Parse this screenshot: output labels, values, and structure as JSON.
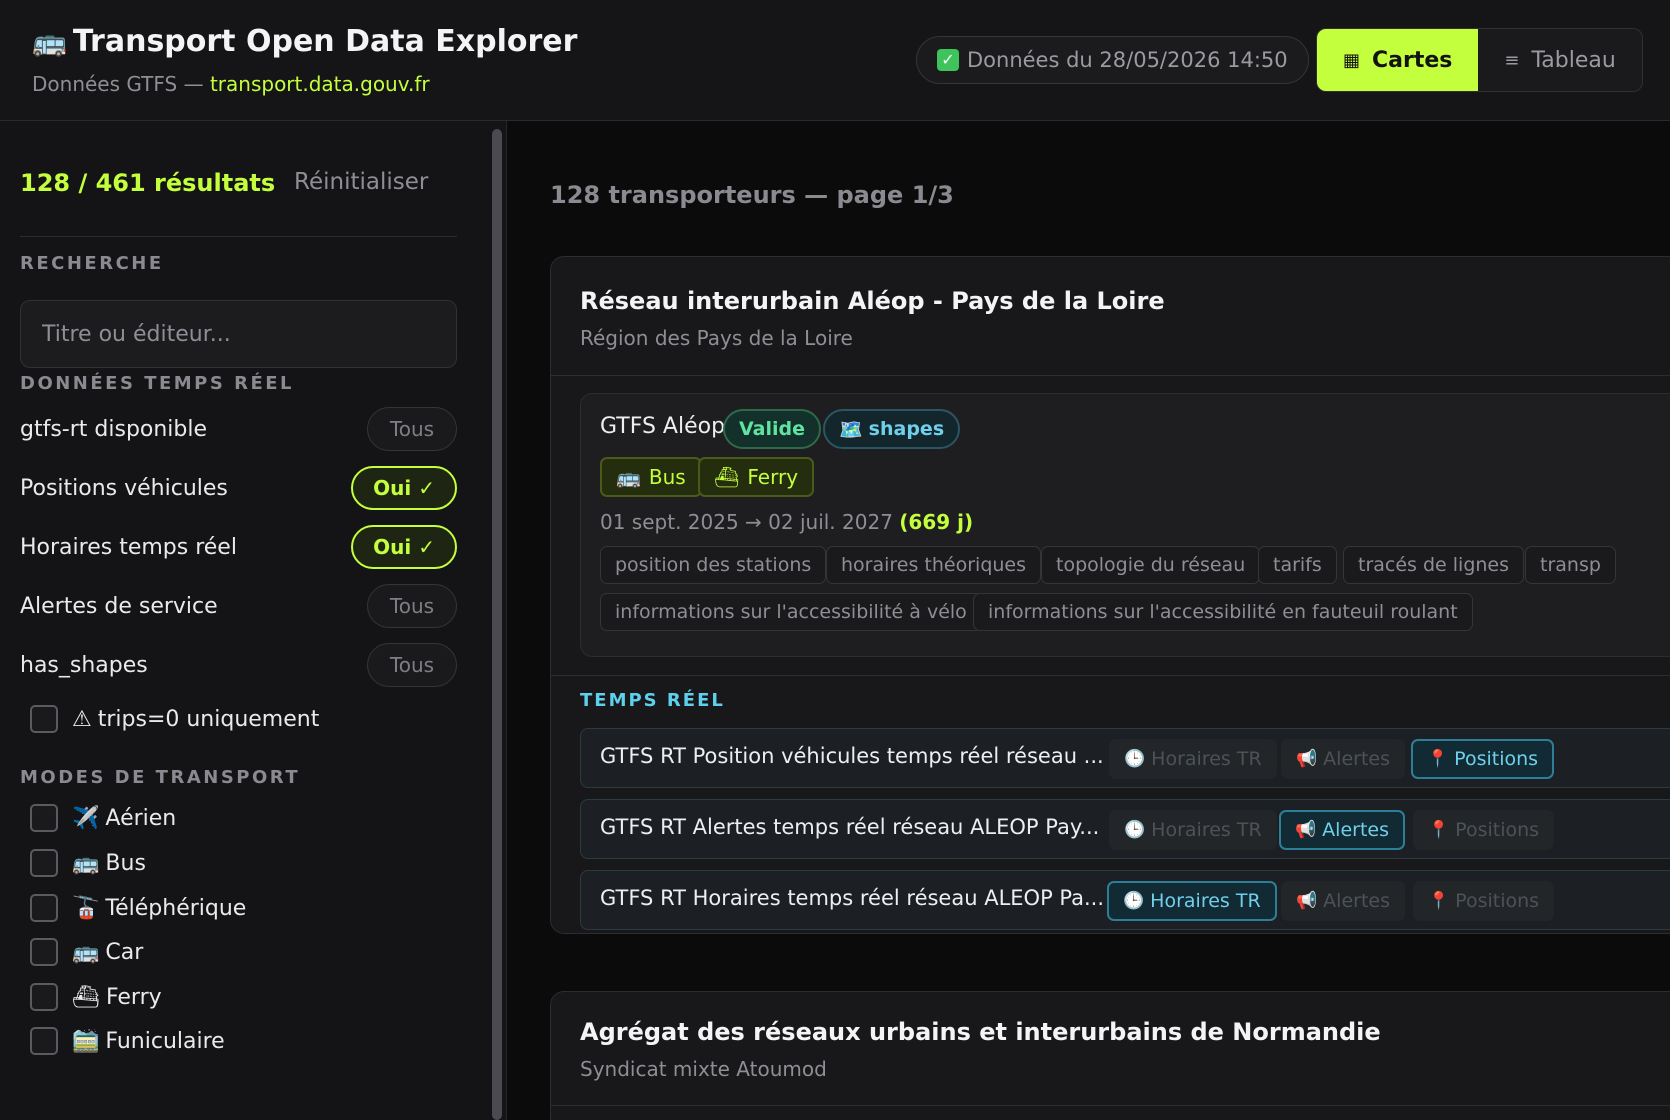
{
  "header": {
    "app_emoji": "🚌",
    "app_title": "Transport Open Data Explorer",
    "subtitle_prefix": "Données GTFS — ",
    "subtitle_link": "transport.data.gouv.fr",
    "status_text": "Données du 28/05/2026 14:50",
    "view_toggle": {
      "cards_icon": "▦",
      "cards_label": "Cartes",
      "table_icon": "≡",
      "table_label": "Tableau"
    }
  },
  "sidebar": {
    "result_count": "128 / 461 résultats",
    "reset_label": "Réinitialiser",
    "search_section": "RECHERCHE",
    "search_placeholder": "Titre ou éditeur...",
    "realtime_section": "DONNÉES TEMPS RÉEL",
    "realtime_filters": [
      {
        "label": "gtfs-rt disponible",
        "value": "Tous",
        "active": false
      },
      {
        "label": "Positions véhicules",
        "value": "Oui ✓",
        "active": true
      },
      {
        "label": "Horaires temps réel",
        "value": "Oui ✓",
        "active": true
      },
      {
        "label": "Alertes de service",
        "value": "Tous",
        "active": false
      },
      {
        "label": "has_shapes",
        "value": "Tous",
        "active": false
      }
    ],
    "trips_zero": {
      "icon": "⚠",
      "label": "trips=0 uniquement"
    },
    "modes_section": "MODES DE TRANSPORT",
    "modes": [
      {
        "emoji": "✈️",
        "label": "Aérien"
      },
      {
        "emoji": "🚌",
        "label": "Bus"
      },
      {
        "emoji": "🚡",
        "label": "Téléphérique"
      },
      {
        "emoji": "🚌",
        "label": "Car"
      },
      {
        "emoji": "⛴",
        "label": "Ferry"
      },
      {
        "emoji": "🚞",
        "label": "Funiculaire"
      }
    ]
  },
  "main": {
    "page_info": "128 transporteurs — page 1/3",
    "cards": [
      {
        "title": "Réseau interurbain Aléop - Pays de la Loire",
        "publisher": "Région des Pays de la Loire",
        "gtfs": {
          "name": "GTFS Aléop",
          "valid_label": "Valide",
          "shapes_emoji": "🗺️",
          "shapes_label": "shapes",
          "modes": [
            {
              "emoji": "🚌",
              "label": "Bus"
            },
            {
              "emoji": "⛴",
              "label": "Ferry"
            }
          ],
          "date_range": "01 sept. 2025 → 02 juil. 2027",
          "days": "(669 j)",
          "tags": [
            "position des stations",
            "horaires théoriques",
            "topologie du réseau",
            "tarifs",
            "tracés de lignes",
            "transp",
            "informations sur l'accessibilité à vélo",
            "informations sur l'accessibilité en fauteuil roulant"
          ]
        },
        "realtime_section": "TEMPS RÉEL",
        "realtime": [
          {
            "name": "GTFS RT Position véhicules temps réel réseau ...",
            "badges": [
              {
                "emoji": "🕒",
                "label": "Horaires TR",
                "active": false
              },
              {
                "emoji": "📢",
                "label": "Alertes",
                "active": false
              },
              {
                "emoji": "📍",
                "label": "Positions",
                "active": true
              }
            ]
          },
          {
            "name": "GTFS RT Alertes temps réel réseau ALEOP Pay...",
            "badges": [
              {
                "emoji": "🕒",
                "label": "Horaires TR",
                "active": false
              },
              {
                "emoji": "📢",
                "label": "Alertes",
                "active": true
              },
              {
                "emoji": "📍",
                "label": "Positions",
                "active": false
              }
            ]
          },
          {
            "name": "GTFS RT Horaires temps réel réseau ALEOP Pa...",
            "badges": [
              {
                "emoji": "🕒",
                "label": "Horaires TR",
                "active": true
              },
              {
                "emoji": "📢",
                "label": "Alertes",
                "active": false
              },
              {
                "emoji": "📍",
                "label": "Positions",
                "active": false
              }
            ]
          }
        ]
      },
      {
        "title": "Agrégat des réseaux urbains et interurbains de Normandie",
        "publisher": "Syndicat mixte Atoumod"
      }
    ]
  },
  "colors": {
    "accent": "#c4ff3d",
    "realtime_accent": "#6fd0ec",
    "valid_green": "#5fe3a1",
    "background": "#0b0b0c"
  }
}
